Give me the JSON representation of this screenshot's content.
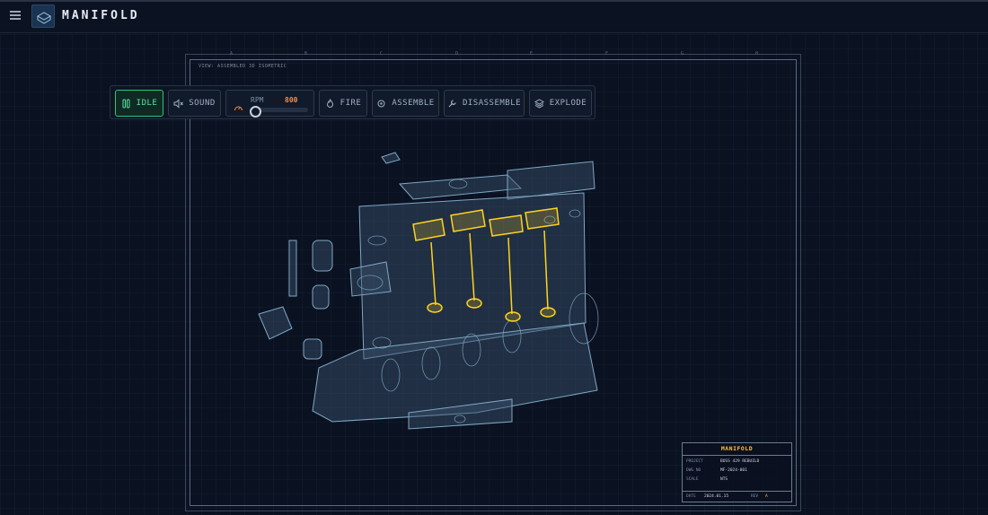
{
  "app": {
    "brand": "MANIFOLD"
  },
  "icons": {
    "menu": "menu-icon",
    "logo": "manifold-logo"
  },
  "viewport": {
    "view_label": "VIEW: ASSEMBLED 3D ISOMETRIC"
  },
  "ruler": {
    "top": [
      "A",
      "B",
      "C",
      "D",
      "E",
      "F",
      "G",
      "H"
    ]
  },
  "toolbar": {
    "idle_label": "IDLE",
    "sound_label": "SOUND",
    "rpm_label": "RPM",
    "rpm_value": "800",
    "fire_label": "FIRE",
    "assemble_label": "ASSEMBLE",
    "disassemble_label": "DISASSEMBLE",
    "explode_label": "EXPLODE",
    "rpm_slider_fraction": 0.0
  },
  "title_block": {
    "title": "MANIFOLD",
    "project_label": "PROJECT",
    "project_value": "BOSS 429 REBUILD",
    "dwg_label": "DWG NO",
    "dwg_value": "MF-2024-001",
    "scale_label": "SCALE",
    "scale_value": "NTS",
    "date_label": "DATE",
    "date_value": "2024.01.15",
    "rev_label": "REV",
    "rev_value": "A"
  },
  "colors": {
    "accent_idle": "#2bc47a",
    "rpm_value": "#ff8a3d",
    "highlight_part": "#ffd21f",
    "wireframe": "#7fa8c4"
  }
}
